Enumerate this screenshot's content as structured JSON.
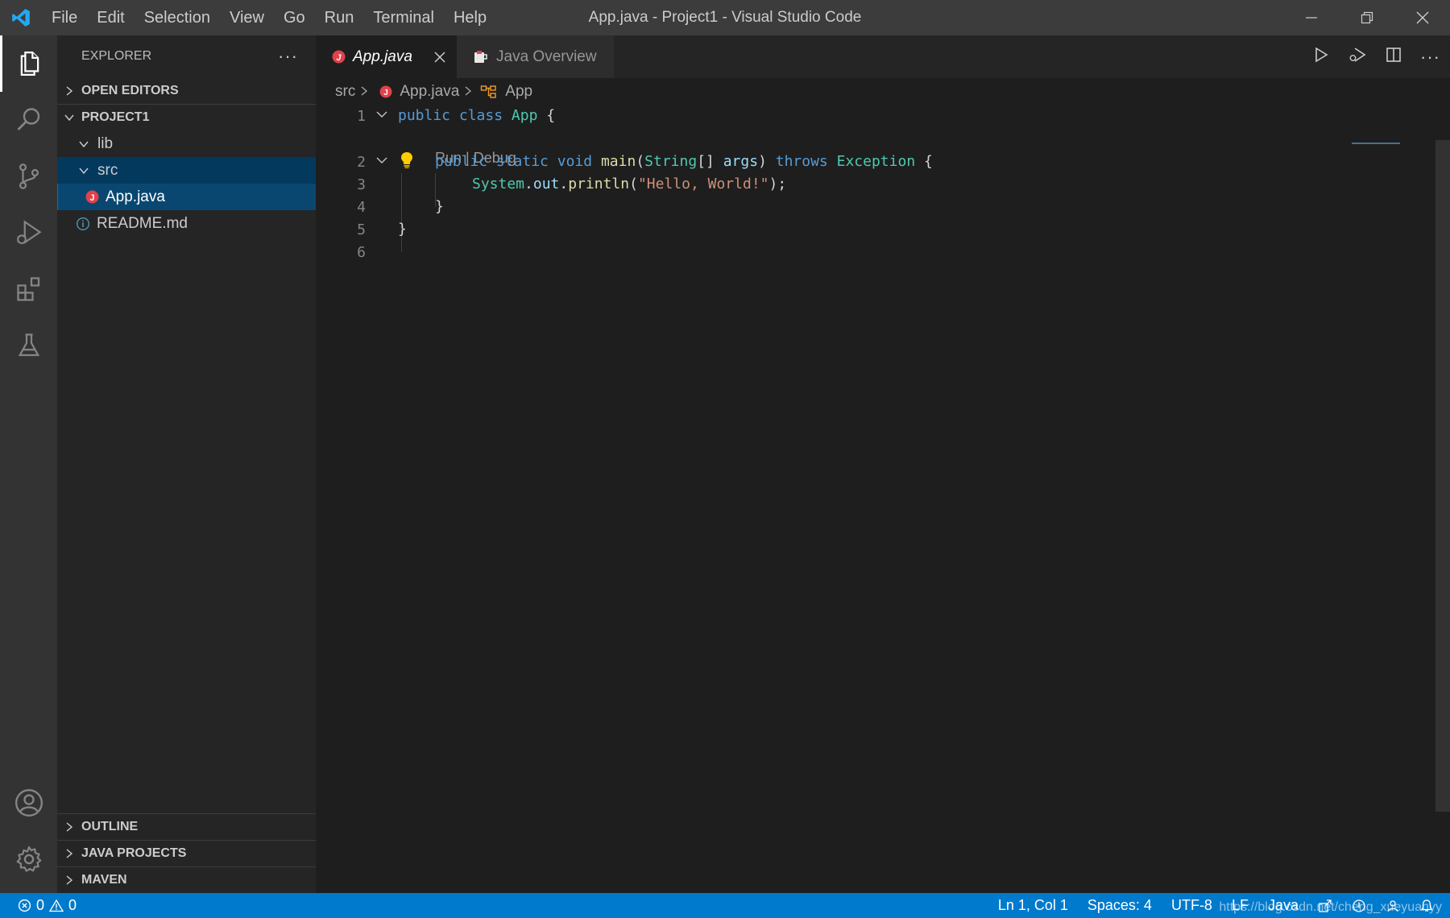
{
  "window": {
    "title": "App.java - Project1 - Visual Studio Code",
    "menu": [
      "File",
      "Edit",
      "Selection",
      "View",
      "Go",
      "Run",
      "Terminal",
      "Help"
    ]
  },
  "activity_bar": {
    "items": [
      "explorer-icon",
      "search-icon",
      "source-control-icon",
      "run-debug-icon",
      "extensions-icon",
      "testing-icon"
    ],
    "bottom": [
      "accounts-icon",
      "settings-gear-icon"
    ]
  },
  "sidebar": {
    "title": "EXPLORER",
    "more": "···",
    "open_editors": "OPEN EDITORS",
    "project": "PROJECT1",
    "tree": [
      {
        "label": "lib"
      },
      {
        "label": "src"
      },
      {
        "label": "App.java"
      },
      {
        "label": "README.md"
      }
    ],
    "outline": "OUTLINE",
    "java_projects": "JAVA PROJECTS",
    "maven": "MAVEN"
  },
  "tabs": [
    {
      "label": "App.java",
      "active": true
    },
    {
      "label": "Java Overview",
      "active": false
    }
  ],
  "breadcrumb": {
    "folder": "src",
    "file": "App.java",
    "symbol": "App"
  },
  "code": {
    "line_numbers": [
      "1",
      "2",
      "3",
      "4",
      "5",
      "6"
    ],
    "codelens": "Run | Debug",
    "line1": {
      "kw1": "public",
      "kw2": "class",
      "name": "App",
      "rest": " {"
    },
    "line2": {
      "kw1": "public",
      "kw2": "static",
      "kw3": "void",
      "fn": "main",
      "p1": "(",
      "type": "String",
      "p2": "[] ",
      "arg": "args",
      "p3": ") ",
      "kw4": "throws",
      "exc": "Exception",
      "rest": " {"
    },
    "line3": {
      "obj": "System",
      "dot1": ".",
      "field": "out",
      "dot2": ".",
      "fn": "println",
      "p1": "(",
      "str": "\"Hello, World!\"",
      "rest": ");"
    },
    "line4": "}",
    "line5": "}"
  },
  "status": {
    "errors": "0",
    "warnings": "0",
    "position": "Ln 1, Col 1",
    "spaces": "Spaces: 4",
    "encoding": "UTF-8",
    "eol": "LF",
    "language": "Java",
    "watermark": "https://blog.csdn.net/cheng_xueyuanyy"
  },
  "colors": {
    "accent": "#007acc",
    "keyword": "#569cd6",
    "type": "#4ec9b0",
    "function": "#dcdcaa",
    "string": "#ce9178",
    "java_icon": "#e1414a"
  }
}
